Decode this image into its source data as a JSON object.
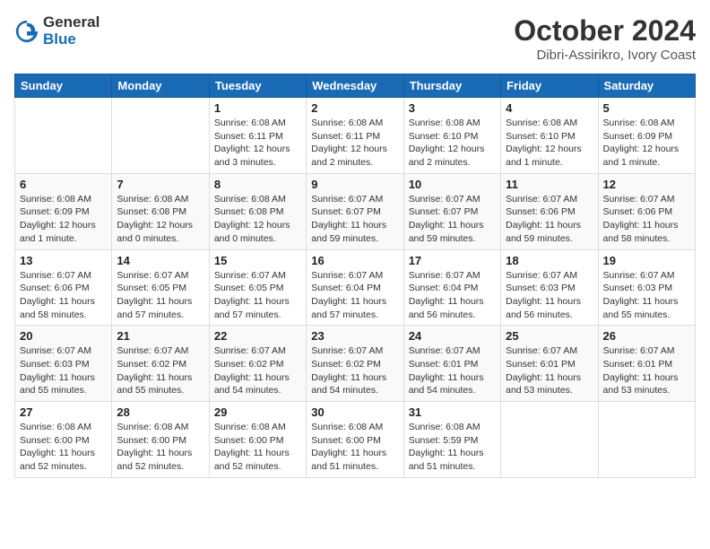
{
  "logo": {
    "general": "General",
    "blue": "Blue"
  },
  "header": {
    "month": "October 2024",
    "location": "Dibri-Assirikro, Ivory Coast"
  },
  "weekdays": [
    "Sunday",
    "Monday",
    "Tuesday",
    "Wednesday",
    "Thursday",
    "Friday",
    "Saturday"
  ],
  "weeks": [
    [
      {
        "day": "",
        "info": ""
      },
      {
        "day": "",
        "info": ""
      },
      {
        "day": "1",
        "info": "Sunrise: 6:08 AM\nSunset: 6:11 PM\nDaylight: 12 hours and 3 minutes."
      },
      {
        "day": "2",
        "info": "Sunrise: 6:08 AM\nSunset: 6:11 PM\nDaylight: 12 hours and 2 minutes."
      },
      {
        "day": "3",
        "info": "Sunrise: 6:08 AM\nSunset: 6:10 PM\nDaylight: 12 hours and 2 minutes."
      },
      {
        "day": "4",
        "info": "Sunrise: 6:08 AM\nSunset: 6:10 PM\nDaylight: 12 hours and 1 minute."
      },
      {
        "day": "5",
        "info": "Sunrise: 6:08 AM\nSunset: 6:09 PM\nDaylight: 12 hours and 1 minute."
      }
    ],
    [
      {
        "day": "6",
        "info": "Sunrise: 6:08 AM\nSunset: 6:09 PM\nDaylight: 12 hours and 1 minute."
      },
      {
        "day": "7",
        "info": "Sunrise: 6:08 AM\nSunset: 6:08 PM\nDaylight: 12 hours and 0 minutes."
      },
      {
        "day": "8",
        "info": "Sunrise: 6:08 AM\nSunset: 6:08 PM\nDaylight: 12 hours and 0 minutes."
      },
      {
        "day": "9",
        "info": "Sunrise: 6:07 AM\nSunset: 6:07 PM\nDaylight: 11 hours and 59 minutes."
      },
      {
        "day": "10",
        "info": "Sunrise: 6:07 AM\nSunset: 6:07 PM\nDaylight: 11 hours and 59 minutes."
      },
      {
        "day": "11",
        "info": "Sunrise: 6:07 AM\nSunset: 6:06 PM\nDaylight: 11 hours and 59 minutes."
      },
      {
        "day": "12",
        "info": "Sunrise: 6:07 AM\nSunset: 6:06 PM\nDaylight: 11 hours and 58 minutes."
      }
    ],
    [
      {
        "day": "13",
        "info": "Sunrise: 6:07 AM\nSunset: 6:06 PM\nDaylight: 11 hours and 58 minutes."
      },
      {
        "day": "14",
        "info": "Sunrise: 6:07 AM\nSunset: 6:05 PM\nDaylight: 11 hours and 57 minutes."
      },
      {
        "day": "15",
        "info": "Sunrise: 6:07 AM\nSunset: 6:05 PM\nDaylight: 11 hours and 57 minutes."
      },
      {
        "day": "16",
        "info": "Sunrise: 6:07 AM\nSunset: 6:04 PM\nDaylight: 11 hours and 57 minutes."
      },
      {
        "day": "17",
        "info": "Sunrise: 6:07 AM\nSunset: 6:04 PM\nDaylight: 11 hours and 56 minutes."
      },
      {
        "day": "18",
        "info": "Sunrise: 6:07 AM\nSunset: 6:03 PM\nDaylight: 11 hours and 56 minutes."
      },
      {
        "day": "19",
        "info": "Sunrise: 6:07 AM\nSunset: 6:03 PM\nDaylight: 11 hours and 55 minutes."
      }
    ],
    [
      {
        "day": "20",
        "info": "Sunrise: 6:07 AM\nSunset: 6:03 PM\nDaylight: 11 hours and 55 minutes."
      },
      {
        "day": "21",
        "info": "Sunrise: 6:07 AM\nSunset: 6:02 PM\nDaylight: 11 hours and 55 minutes."
      },
      {
        "day": "22",
        "info": "Sunrise: 6:07 AM\nSunset: 6:02 PM\nDaylight: 11 hours and 54 minutes."
      },
      {
        "day": "23",
        "info": "Sunrise: 6:07 AM\nSunset: 6:02 PM\nDaylight: 11 hours and 54 minutes."
      },
      {
        "day": "24",
        "info": "Sunrise: 6:07 AM\nSunset: 6:01 PM\nDaylight: 11 hours and 54 minutes."
      },
      {
        "day": "25",
        "info": "Sunrise: 6:07 AM\nSunset: 6:01 PM\nDaylight: 11 hours and 53 minutes."
      },
      {
        "day": "26",
        "info": "Sunrise: 6:07 AM\nSunset: 6:01 PM\nDaylight: 11 hours and 53 minutes."
      }
    ],
    [
      {
        "day": "27",
        "info": "Sunrise: 6:08 AM\nSunset: 6:00 PM\nDaylight: 11 hours and 52 minutes."
      },
      {
        "day": "28",
        "info": "Sunrise: 6:08 AM\nSunset: 6:00 PM\nDaylight: 11 hours and 52 minutes."
      },
      {
        "day": "29",
        "info": "Sunrise: 6:08 AM\nSunset: 6:00 PM\nDaylight: 11 hours and 52 minutes."
      },
      {
        "day": "30",
        "info": "Sunrise: 6:08 AM\nSunset: 6:00 PM\nDaylight: 11 hours and 51 minutes."
      },
      {
        "day": "31",
        "info": "Sunrise: 6:08 AM\nSunset: 5:59 PM\nDaylight: 11 hours and 51 minutes."
      },
      {
        "day": "",
        "info": ""
      },
      {
        "day": "",
        "info": ""
      }
    ]
  ]
}
